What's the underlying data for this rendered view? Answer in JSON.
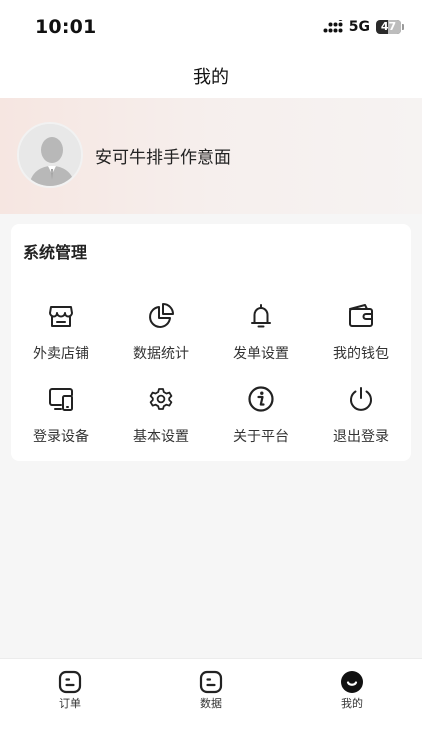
{
  "status_bar": {
    "time": "10:01",
    "network": "5G",
    "battery": "47"
  },
  "header": {
    "title": "我的"
  },
  "profile": {
    "shop_name": "安可牛排手作意面"
  },
  "system_management": {
    "title": "系统管理",
    "items": [
      {
        "label": "外卖店铺",
        "icon": "store-icon"
      },
      {
        "label": "数据统计",
        "icon": "pie-chart-icon"
      },
      {
        "label": "发单设置",
        "icon": "bell-icon"
      },
      {
        "label": "我的钱包",
        "icon": "wallet-icon"
      },
      {
        "label": "登录设备",
        "icon": "devices-icon"
      },
      {
        "label": "基本设置",
        "icon": "gear-icon"
      },
      {
        "label": "关于平台",
        "icon": "info-icon"
      },
      {
        "label": "退出登录",
        "icon": "power-icon"
      }
    ]
  },
  "tab_bar": {
    "tabs": [
      {
        "label": "订单",
        "icon": "order-tab-icon",
        "active": false
      },
      {
        "label": "数据",
        "icon": "data-tab-icon",
        "active": false
      },
      {
        "label": "我的",
        "icon": "profile-tab-icon",
        "active": true
      }
    ]
  }
}
